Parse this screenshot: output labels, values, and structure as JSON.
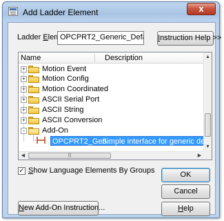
{
  "window": {
    "title": "Add Ladder Element",
    "close_glyph": "x"
  },
  "ladder_element": {
    "label_pre": "Ladder ",
    "label_accel": "E",
    "label_post": "lement:",
    "value": "OPCPRT2_Generic_Default"
  },
  "buttons": {
    "instruction_help": {
      "accel": "I",
      "rest": "nstruction Help >>"
    },
    "ok": "OK",
    "cancel": "Cancel",
    "help": {
      "accel": "H",
      "rest": "elp"
    },
    "new_addon": {
      "accel": "N",
      "rest": "ew Add-On Instruction..."
    }
  },
  "tree": {
    "columns": [
      "Name",
      "Description"
    ],
    "items": [
      {
        "label": "Motion Event",
        "expander": "+"
      },
      {
        "label": "Motion Config",
        "expander": "+"
      },
      {
        "label": "Motion Coordinated",
        "expander": "+"
      },
      {
        "label": "ASCII Serial Port",
        "expander": "+"
      },
      {
        "label": "ASCII String",
        "expander": "+"
      },
      {
        "label": "ASCII Conversion",
        "expander": "+"
      },
      {
        "label": "Add-On",
        "expander": "-"
      }
    ],
    "selected": {
      "name": "OPCPRT2_Gen...",
      "description": "Simple interface for generic default..."
    }
  },
  "checkbox": {
    "checked_glyph": "✓",
    "accel": "S",
    "rest": "how Language Elements By Groups"
  }
}
